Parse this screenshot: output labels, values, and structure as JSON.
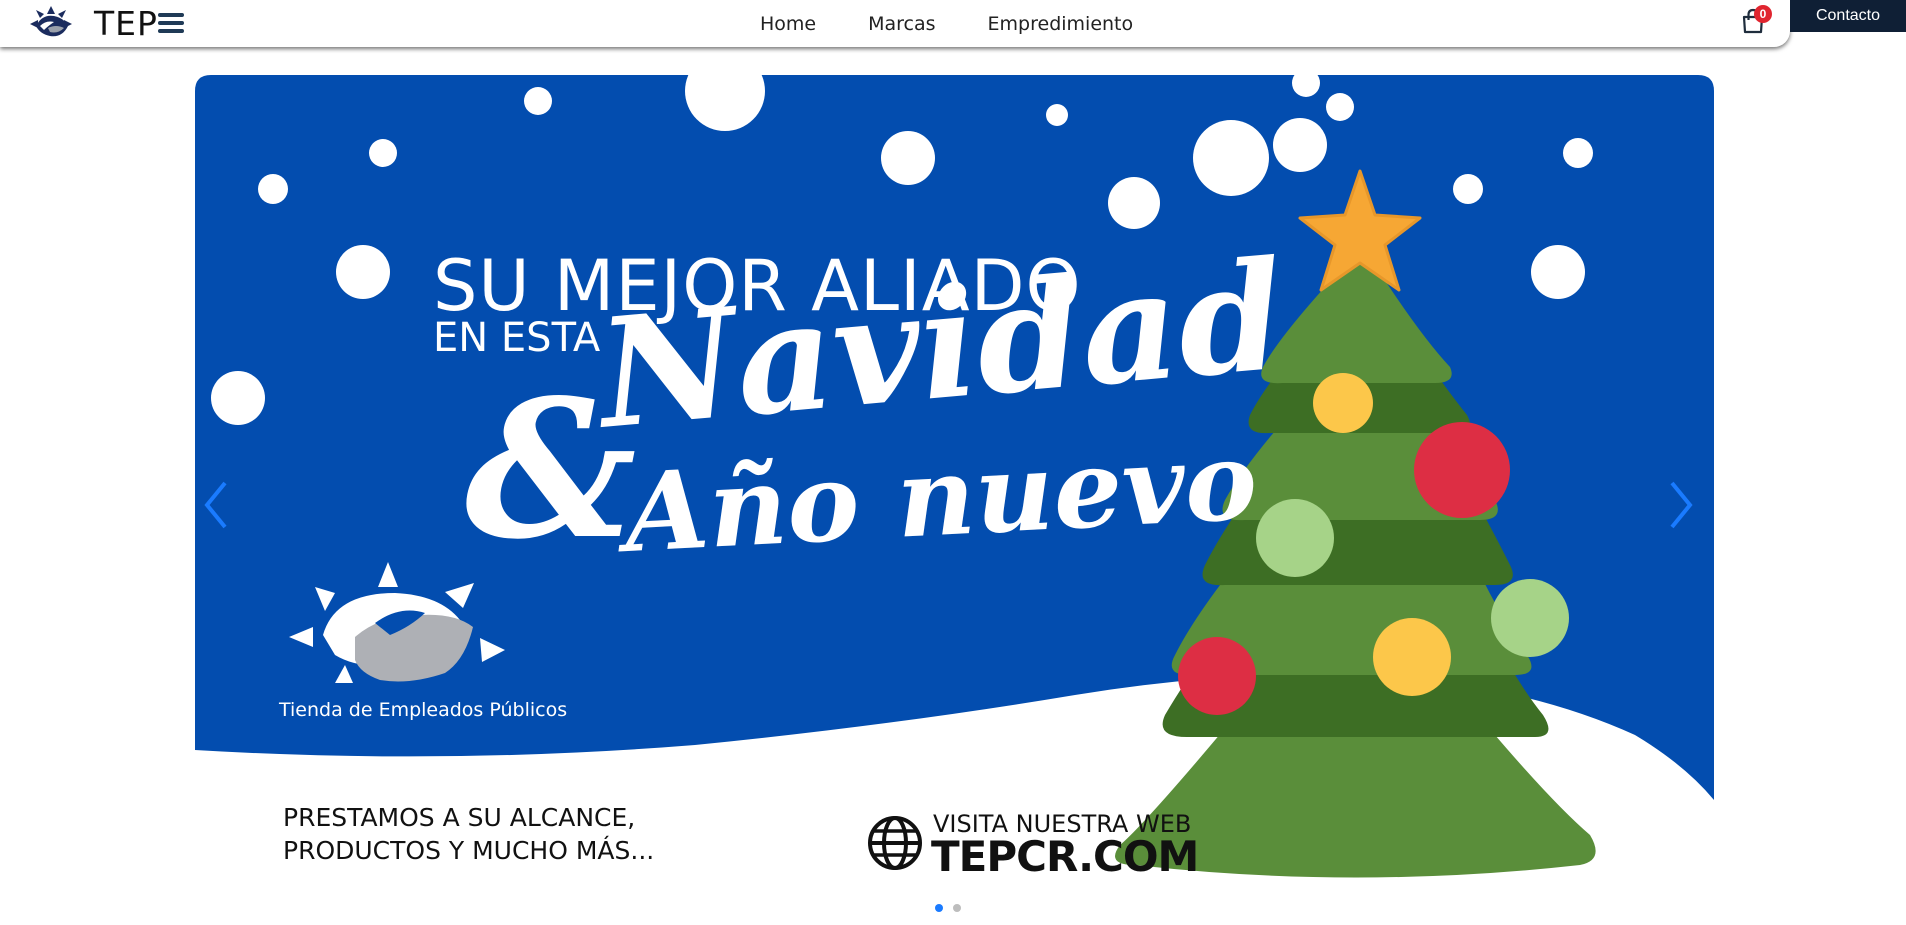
{
  "nav": {
    "brand": "TEP",
    "links": [
      "Home",
      "Marcas",
      "Empredimiento"
    ],
    "cart_count": "0",
    "contact_label": "Contacto"
  },
  "banner": {
    "headline_line1": "SU MEJOR ALIADO",
    "headline_line2": "EN ESTA",
    "ampersand": "&",
    "script_line1": "Navidad",
    "script_line2": "Año nuevo",
    "logo_caption": "Tienda de Empleados Públicos",
    "tagline_line1": "PRESTAMOS A SU ALCANCE,",
    "tagline_line2": "PRODUCTOS Y MUCHO MÁS...",
    "web_line1": "VISITA NUESTRA WEB",
    "web_line2": "TEPCR.COM"
  },
  "carousel": {
    "slide_count": 2,
    "active_index": 0
  },
  "colors": {
    "banner_blue": "#034daf",
    "navbar_dark": "#0f1f35",
    "badge_red": "#e0252f",
    "indicator_active": "#1a7bff",
    "arrow_blue": "#1a7bff"
  },
  "icons": {
    "brand_logo": "handshake-sun-logo",
    "menu": "hamburger-icon",
    "cart": "shopping-bag-icon",
    "prev": "chevron-left-icon",
    "next": "chevron-right-icon",
    "web": "globe-icon"
  }
}
